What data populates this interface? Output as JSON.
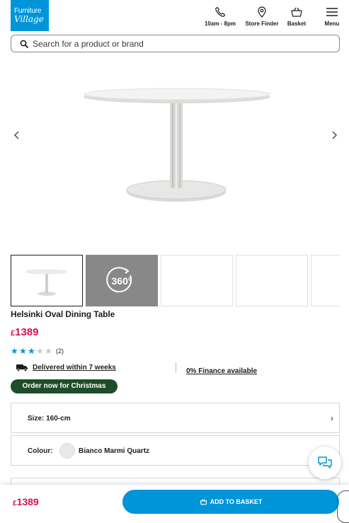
{
  "brand": {
    "line1": "Furniture",
    "line2": "Village",
    "color": "#0095d9"
  },
  "header": {
    "nav": [
      {
        "icon": "phone-icon",
        "label": "10am - 8pm"
      },
      {
        "icon": "map-pin-icon",
        "label": "Store Finder"
      },
      {
        "icon": "basket-icon",
        "label": "Basket"
      },
      {
        "icon": "hamburger-icon",
        "label": "Menu"
      }
    ]
  },
  "search": {
    "placeholder": "Search for a product or brand",
    "value": ""
  },
  "gallery": {
    "thumbnails": [
      {
        "type": "image",
        "selected": true
      },
      {
        "type": "360",
        "label": "360°"
      },
      {
        "type": "image"
      },
      {
        "type": "image"
      },
      {
        "type": "image"
      }
    ]
  },
  "product": {
    "name": "Helsinki Oval Dining Table",
    "currency": "£",
    "price": "1389",
    "price_color": "#d3134f",
    "rating": 3,
    "rating_max": 5,
    "review_count": "(2)",
    "delivery_text": "Delivered within 7 weeks",
    "finance_text": "0% Finance available",
    "badge": "Order now for Christmas",
    "badge_color": "#1f4d2b"
  },
  "options": {
    "size_label": "Size:",
    "size_value": "160-cm",
    "colour_label": "Colour:",
    "colour_value": "Bianco Marmi Quartz"
  },
  "bottom_bar": {
    "currency": "£",
    "price": "1389",
    "button_label": "ADD TO BASKET",
    "button_color": "#0095d9"
  }
}
